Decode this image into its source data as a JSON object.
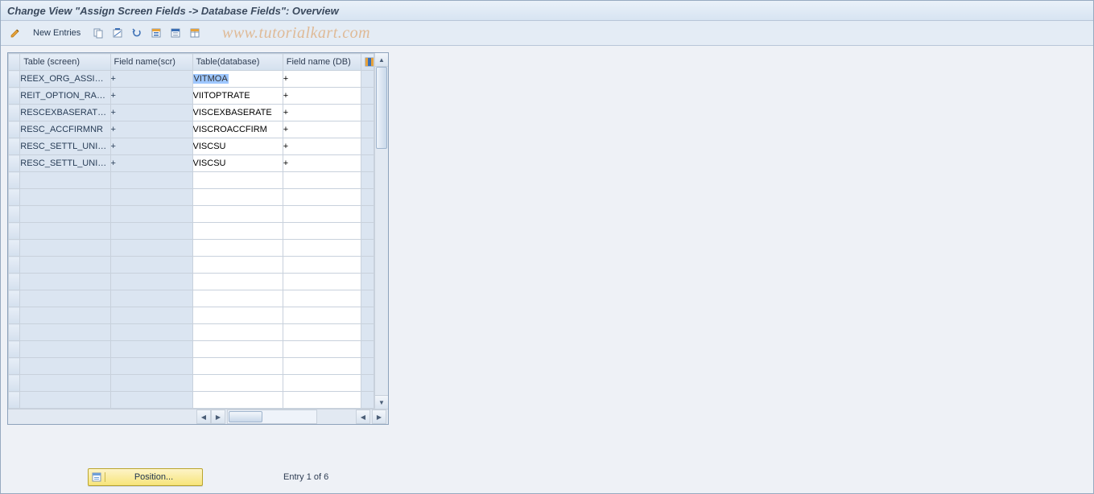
{
  "title": "Change View \"Assign Screen Fields -> Database Fields\": Overview",
  "toolbar": {
    "new_entries": "New Entries"
  },
  "watermark": "www.tutorialkart.com",
  "columns": {
    "sel": "",
    "table_screen": "Table (screen)",
    "field_name_scr": "Field name(scr)",
    "table_database": "Table(database)",
    "field_name_db": "Field name (DB)"
  },
  "rows": [
    {
      "table_screen": "REEX_ORG_ASSIG…",
      "field_name_scr": "+",
      "table_database": "VITMOA",
      "field_name_db": "+",
      "selected_db": true
    },
    {
      "table_screen": "REIT_OPTION_RA…",
      "field_name_scr": "+",
      "table_database": "VIITOPTRATE",
      "field_name_db": "+"
    },
    {
      "table_screen": "RESCEXBASERATE…",
      "field_name_scr": "+",
      "table_database": "VISCEXBASERATE",
      "field_name_db": "+"
    },
    {
      "table_screen": "RESC_ACCFIRMNR",
      "field_name_scr": "+",
      "table_database": "VISCROACCFIRM",
      "field_name_db": "+"
    },
    {
      "table_screen": "RESC_SETTL_UNI…",
      "field_name_scr": "+",
      "table_database": "VISCSU",
      "field_name_db": "+"
    },
    {
      "table_screen": "RESC_SETTL_UNI…",
      "field_name_scr": "+",
      "table_database": "VISCSU",
      "field_name_db": "+"
    }
  ],
  "empty_rows": 14,
  "footer": {
    "position_label": "Position...",
    "entry_text": "Entry 1 of 6"
  }
}
